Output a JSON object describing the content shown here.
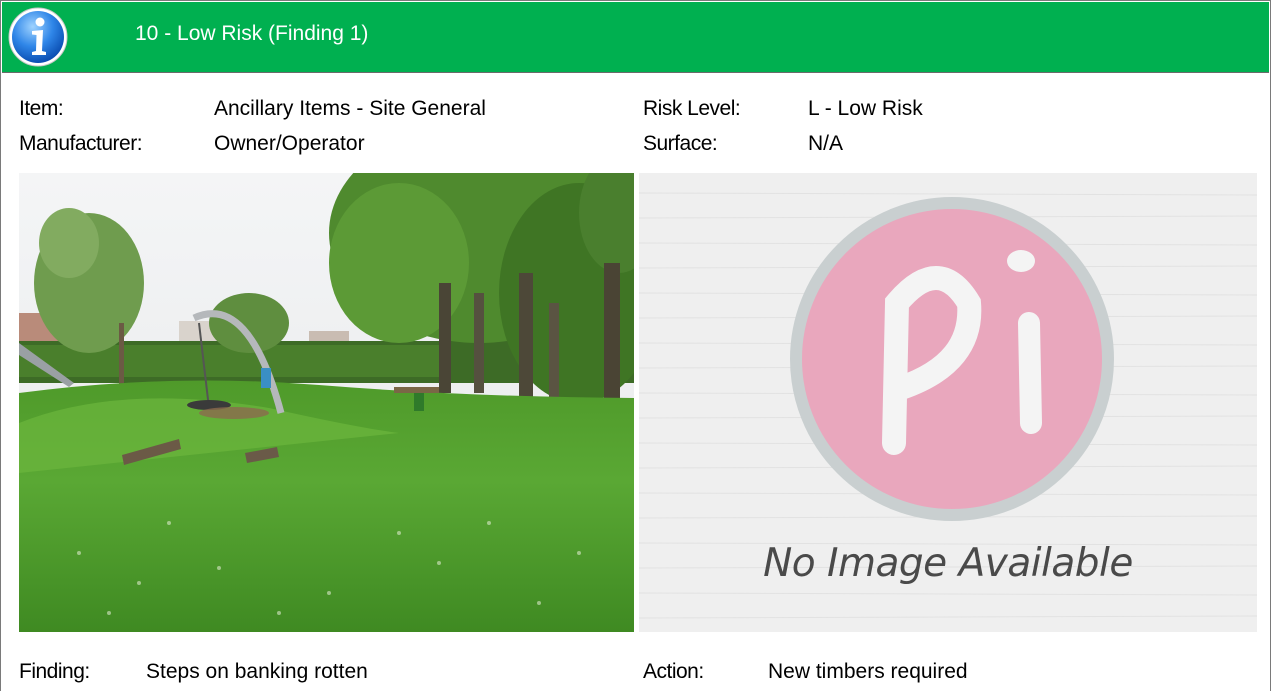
{
  "header": {
    "title": "10 - Low Risk (Finding 1)",
    "background_color": "#00b050",
    "icon": "info-icon"
  },
  "details": {
    "item_label": "Item:",
    "item_value": "Ancillary Items - Site General",
    "manufacturer_label": "Manufacturer:",
    "manufacturer_value": "Owner/Operator",
    "risk_level_label": "Risk Level:",
    "risk_level_value": "L - Low Risk",
    "surface_label": "Surface:",
    "surface_value": "N/A"
  },
  "images": {
    "photo": "playground-photo",
    "placeholder_text": "No Image Available"
  },
  "finding": {
    "finding_label": "Finding:",
    "finding_value": "Steps on banking rotten",
    "action_label": "Action:",
    "action_value": "New timbers required"
  }
}
